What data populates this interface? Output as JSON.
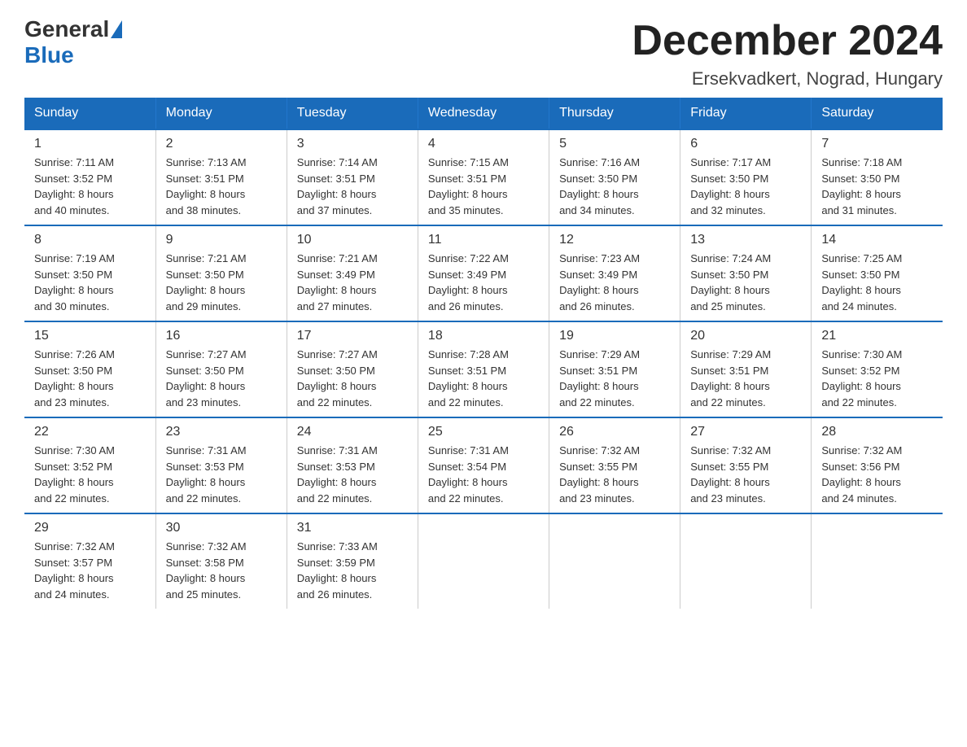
{
  "logo": {
    "general": "General",
    "blue": "Blue"
  },
  "title": "December 2024",
  "subtitle": "Ersekvadkert, Nograd, Hungary",
  "days_of_week": [
    "Sunday",
    "Monday",
    "Tuesday",
    "Wednesday",
    "Thursday",
    "Friday",
    "Saturday"
  ],
  "weeks": [
    [
      {
        "day": "1",
        "sunrise": "7:11 AM",
        "sunset": "3:52 PM",
        "daylight": "8 hours and 40 minutes."
      },
      {
        "day": "2",
        "sunrise": "7:13 AM",
        "sunset": "3:51 PM",
        "daylight": "8 hours and 38 minutes."
      },
      {
        "day": "3",
        "sunrise": "7:14 AM",
        "sunset": "3:51 PM",
        "daylight": "8 hours and 37 minutes."
      },
      {
        "day": "4",
        "sunrise": "7:15 AM",
        "sunset": "3:51 PM",
        "daylight": "8 hours and 35 minutes."
      },
      {
        "day": "5",
        "sunrise": "7:16 AM",
        "sunset": "3:50 PM",
        "daylight": "8 hours and 34 minutes."
      },
      {
        "day": "6",
        "sunrise": "7:17 AM",
        "sunset": "3:50 PM",
        "daylight": "8 hours and 32 minutes."
      },
      {
        "day": "7",
        "sunrise": "7:18 AM",
        "sunset": "3:50 PM",
        "daylight": "8 hours and 31 minutes."
      }
    ],
    [
      {
        "day": "8",
        "sunrise": "7:19 AM",
        "sunset": "3:50 PM",
        "daylight": "8 hours and 30 minutes."
      },
      {
        "day": "9",
        "sunrise": "7:21 AM",
        "sunset": "3:50 PM",
        "daylight": "8 hours and 29 minutes."
      },
      {
        "day": "10",
        "sunrise": "7:21 AM",
        "sunset": "3:49 PM",
        "daylight": "8 hours and 27 minutes."
      },
      {
        "day": "11",
        "sunrise": "7:22 AM",
        "sunset": "3:49 PM",
        "daylight": "8 hours and 26 minutes."
      },
      {
        "day": "12",
        "sunrise": "7:23 AM",
        "sunset": "3:49 PM",
        "daylight": "8 hours and 26 minutes."
      },
      {
        "day": "13",
        "sunrise": "7:24 AM",
        "sunset": "3:50 PM",
        "daylight": "8 hours and 25 minutes."
      },
      {
        "day": "14",
        "sunrise": "7:25 AM",
        "sunset": "3:50 PM",
        "daylight": "8 hours and 24 minutes."
      }
    ],
    [
      {
        "day": "15",
        "sunrise": "7:26 AM",
        "sunset": "3:50 PM",
        "daylight": "8 hours and 23 minutes."
      },
      {
        "day": "16",
        "sunrise": "7:27 AM",
        "sunset": "3:50 PM",
        "daylight": "8 hours and 23 minutes."
      },
      {
        "day": "17",
        "sunrise": "7:27 AM",
        "sunset": "3:50 PM",
        "daylight": "8 hours and 22 minutes."
      },
      {
        "day": "18",
        "sunrise": "7:28 AM",
        "sunset": "3:51 PM",
        "daylight": "8 hours and 22 minutes."
      },
      {
        "day": "19",
        "sunrise": "7:29 AM",
        "sunset": "3:51 PM",
        "daylight": "8 hours and 22 minutes."
      },
      {
        "day": "20",
        "sunrise": "7:29 AM",
        "sunset": "3:51 PM",
        "daylight": "8 hours and 22 minutes."
      },
      {
        "day": "21",
        "sunrise": "7:30 AM",
        "sunset": "3:52 PM",
        "daylight": "8 hours and 22 minutes."
      }
    ],
    [
      {
        "day": "22",
        "sunrise": "7:30 AM",
        "sunset": "3:52 PM",
        "daylight": "8 hours and 22 minutes."
      },
      {
        "day": "23",
        "sunrise": "7:31 AM",
        "sunset": "3:53 PM",
        "daylight": "8 hours and 22 minutes."
      },
      {
        "day": "24",
        "sunrise": "7:31 AM",
        "sunset": "3:53 PM",
        "daylight": "8 hours and 22 minutes."
      },
      {
        "day": "25",
        "sunrise": "7:31 AM",
        "sunset": "3:54 PM",
        "daylight": "8 hours and 22 minutes."
      },
      {
        "day": "26",
        "sunrise": "7:32 AM",
        "sunset": "3:55 PM",
        "daylight": "8 hours and 23 minutes."
      },
      {
        "day": "27",
        "sunrise": "7:32 AM",
        "sunset": "3:55 PM",
        "daylight": "8 hours and 23 minutes."
      },
      {
        "day": "28",
        "sunrise": "7:32 AM",
        "sunset": "3:56 PM",
        "daylight": "8 hours and 24 minutes."
      }
    ],
    [
      {
        "day": "29",
        "sunrise": "7:32 AM",
        "sunset": "3:57 PM",
        "daylight": "8 hours and 24 minutes."
      },
      {
        "day": "30",
        "sunrise": "7:32 AM",
        "sunset": "3:58 PM",
        "daylight": "8 hours and 25 minutes."
      },
      {
        "day": "31",
        "sunrise": "7:33 AM",
        "sunset": "3:59 PM",
        "daylight": "8 hours and 26 minutes."
      },
      null,
      null,
      null,
      null
    ]
  ],
  "labels": {
    "sunrise": "Sunrise:",
    "sunset": "Sunset:",
    "daylight": "Daylight:"
  }
}
